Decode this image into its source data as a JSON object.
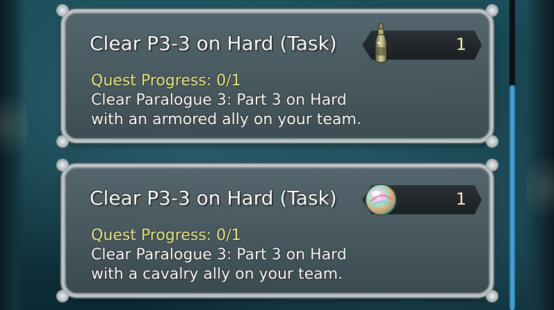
{
  "quests": [
    {
      "title": "Clear P3-3 on Hard (Task)",
      "progress": "Quest Progress: 0/1",
      "description_lines": [
        "Clear Paralogue 3: Part 3 on Hard",
        "with an armored ally on your team."
      ],
      "reward": {
        "icon": "dueling-crest-bottle-icon",
        "count": "1"
      }
    },
    {
      "title": "Clear P3-3 on Hard (Task)",
      "progress": "Quest Progress: 0/1",
      "description_lines": [
        "Clear Paralogue 3: Part 3 on Hard",
        "with a cavalry ally on your team."
      ],
      "reward": {
        "icon": "rainbow-orb-icon",
        "count": "1"
      }
    }
  ],
  "colors": {
    "progress_text": "#f1ed8a",
    "reward_count": "#fff6c4",
    "scrollbar": "#4fa7d8"
  }
}
